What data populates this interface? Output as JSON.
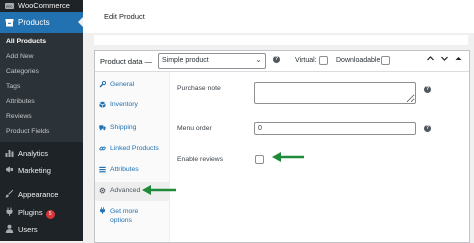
{
  "sidebar": {
    "woocommerce_label": "WooCommerce",
    "products_label": "Products",
    "submenu": [
      "All Products",
      "Add New",
      "Categories",
      "Tags",
      "Attributes",
      "Reviews",
      "Product Fields"
    ],
    "analytics_label": "Analytics",
    "marketing_label": "Marketing",
    "appearance_label": "Appearance",
    "plugins_label": "Plugins",
    "plugins_badge": "5",
    "users_label": "Users"
  },
  "header": {
    "title": "Edit Product"
  },
  "panel": {
    "label": "Product data —",
    "type_value": "Simple product",
    "virtual_label": "Virtual:",
    "downloadable_label": "Downloadable:"
  },
  "tabs": {
    "general": "General",
    "inventory": "Inventory",
    "shipping": "Shipping",
    "linked": "Linked Products",
    "attributes": "Attributes",
    "advanced": "Advanced",
    "more_line1": "Get more",
    "more_line2": "options"
  },
  "fields": {
    "purchase_note_label": "Purchase note",
    "purchase_note_value": "",
    "menu_order_label": "Menu order",
    "menu_order_value": "0",
    "enable_reviews_label": "Enable reviews",
    "enable_reviews_checked": false
  },
  "colors": {
    "admin_bar": "#1d2327",
    "submenu_bg": "#2c3338",
    "accent": "#2271b1",
    "badge": "#d63638",
    "arrow_annotation": "#1e8a3a"
  }
}
